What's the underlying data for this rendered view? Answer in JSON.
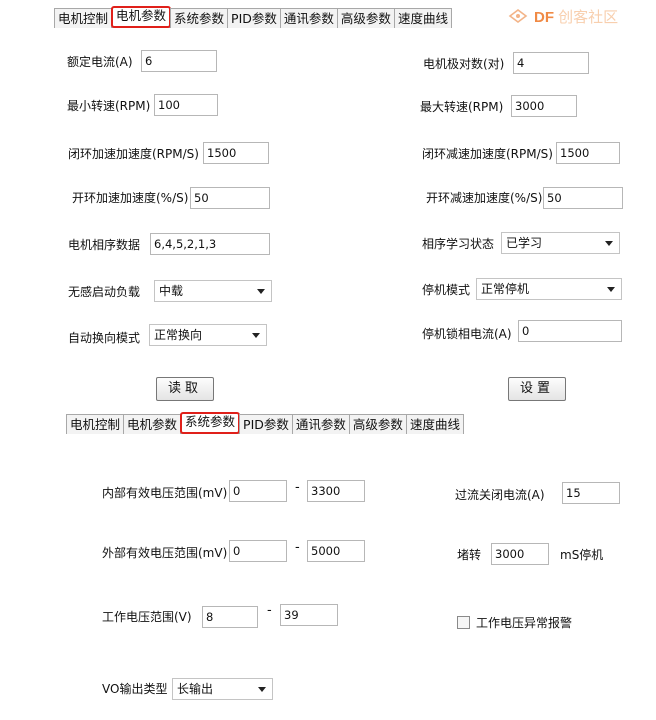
{
  "watermark": {
    "df": "DF",
    "text": "创客社区"
  },
  "top_tabs": [
    {
      "label": "电机控制",
      "active": false
    },
    {
      "label": "电机参数",
      "active": true
    },
    {
      "label": "系统参数",
      "active": false
    },
    {
      "label": "PID参数",
      "active": false
    },
    {
      "label": "通讯参数",
      "active": false
    },
    {
      "label": "高级参数",
      "active": false
    },
    {
      "label": "速度曲线",
      "active": false
    }
  ],
  "motor_params": {
    "rated_current": {
      "label": "额定电流(A)",
      "value": "6"
    },
    "pole_pairs": {
      "label": "电机极对数(对)",
      "value": "4"
    },
    "min_speed": {
      "label": "最小转速(RPM)",
      "value": "100"
    },
    "max_speed": {
      "label": "最大转速(RPM)",
      "value": "3000"
    },
    "closed_accel": {
      "label": "闭环加速加速度(RPM/S)",
      "value": "1500"
    },
    "closed_decel": {
      "label": "闭环减速加速度(RPM/S)",
      "value": "1500"
    },
    "open_accel": {
      "label": "开环加速加速度(%/S)",
      "value": "50"
    },
    "open_decel": {
      "label": "开环减速加速度(%/S)",
      "value": "50"
    },
    "phase_seq": {
      "label": "电机相序数据",
      "value": "6,4,5,2,1,3"
    },
    "phase_learn": {
      "label": "相序学习状态",
      "value": "已学习"
    },
    "sensorless_load": {
      "label": "无感启动负载",
      "value": "中载"
    },
    "stop_mode": {
      "label": "停机模式",
      "value": "正常停机"
    },
    "auto_commutation": {
      "label": "自动换向模式",
      "value": "正常换向"
    },
    "stop_lock_current": {
      "label": "停机锁相电流(A)",
      "value": "0"
    },
    "read_button": "读取",
    "set_button": "设置"
  },
  "bottom_tabs": [
    {
      "label": "电机控制",
      "active": false
    },
    {
      "label": "电机参数",
      "active": false
    },
    {
      "label": "系统参数",
      "active": true
    },
    {
      "label": "PID参数",
      "active": false
    },
    {
      "label": "通讯参数",
      "active": false
    },
    {
      "label": "高级参数",
      "active": false
    },
    {
      "label": "速度曲线",
      "active": false
    }
  ],
  "system_params": {
    "internal_voltage": {
      "label": "内部有效电压范围(mV)",
      "min": "0",
      "max": "3300"
    },
    "external_voltage": {
      "label": "外部有效电压范围(mV)",
      "min": "0",
      "max": "5000"
    },
    "work_voltage": {
      "label": "工作电压范围(V)",
      "min": "8",
      "max": "39"
    },
    "overcurrent": {
      "label": "过流关闭电流(A)",
      "value": "15"
    },
    "stall": {
      "label": "堵转",
      "value": "3000",
      "suffix": "mS停机"
    },
    "voltage_alarm": {
      "label": "工作电压异常报警",
      "checked": false
    },
    "vo_output": {
      "label": "VO输出类型",
      "value": "长输出"
    },
    "dash": "-"
  }
}
